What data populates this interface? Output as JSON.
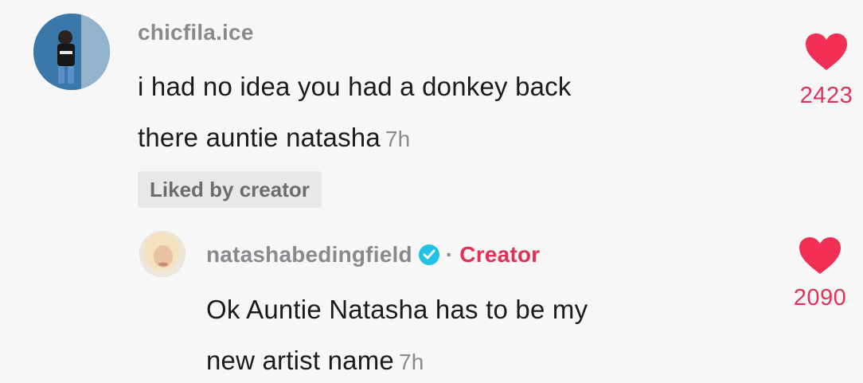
{
  "comment": {
    "username": "chicfila.ice",
    "text_line1": "i had no idea you had a donkey back",
    "text_line2": "there auntie natasha",
    "time": "7h",
    "liked_badge": "Liked by creator",
    "likes": "2423"
  },
  "reply": {
    "username": "natashabedingfield",
    "separator": "·",
    "creator_label": "Creator",
    "text_line1": "Ok Auntie Natasha has to be my",
    "text_line2": "new artist name",
    "time": "7h",
    "likes": "2090"
  },
  "colors": {
    "accent": "#e03256",
    "verified": "#20c0e8",
    "background": "#f8f7f8"
  },
  "icons": {
    "like": "heart-icon",
    "verified": "verified-badge-icon"
  }
}
